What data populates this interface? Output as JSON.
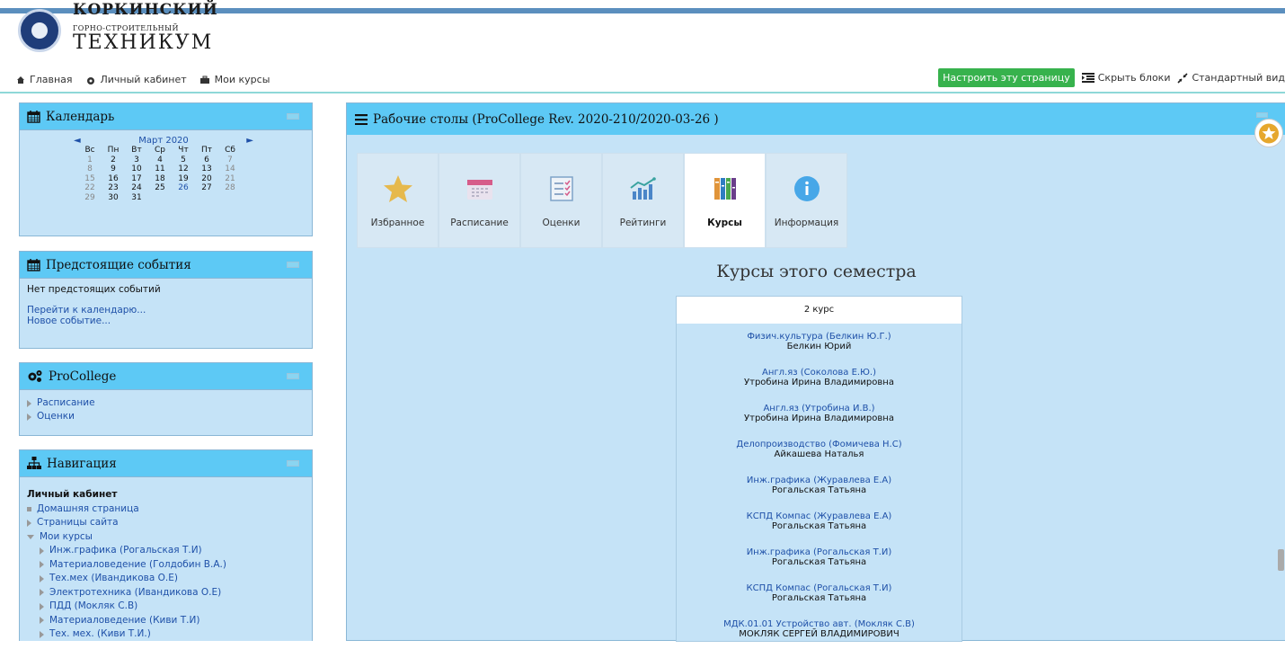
{
  "logo": {
    "line1": "КОРКИНСКИЙ",
    "line2": "ГОРНО-СТРОИТЕЛЬНЫЙ",
    "line3": "ТЕХНИКУМ"
  },
  "nav": {
    "home": "Главная",
    "cabinet": "Личный кабинет",
    "my_courses": "Мои курсы",
    "customize_btn": "Настроить эту страницу",
    "hide_blocks": "Скрыть блоки",
    "standard_view": "Стандартный вид"
  },
  "calendar": {
    "title": "Календарь",
    "prev": "◄",
    "next": "►",
    "month": "Март 2020",
    "weekdays": [
      "Вс",
      "Пн",
      "Вт",
      "Ср",
      "Чт",
      "Пт",
      "Сб"
    ],
    "days": [
      [
        "1",
        "2",
        "3",
        "4",
        "5",
        "6",
        "7"
      ],
      [
        "8",
        "9",
        "10",
        "11",
        "12",
        "13",
        "14"
      ],
      [
        "15",
        "16",
        "17",
        "18",
        "19",
        "20",
        "21"
      ],
      [
        "22",
        "23",
        "24",
        "25",
        "26",
        "27",
        "28"
      ],
      [
        "29",
        "30",
        "31",
        "",
        "",
        "",
        ""
      ]
    ],
    "today": "26"
  },
  "events": {
    "title": "Предстоящие события",
    "empty": "Нет предстоящих событий",
    "goto_calendar": "Перейти к календарю...",
    "new_event": "Новое событие..."
  },
  "procollege": {
    "title": "ProCollege",
    "items": [
      "Расписание",
      "Оценки"
    ]
  },
  "navigation": {
    "title": "Навигация",
    "root": "Личный кабинет",
    "home_page": "Домашняя страница",
    "site_pages": "Страницы сайта",
    "my_courses": "Мои курсы",
    "courses": [
      "Инж.графика (Рогальская Т.И)",
      "Материаловедение (Голдобин В.А.)",
      "Тех.мех (Ивандикова О.Е)",
      "Электротехника (Ивандикова О.Е)",
      "ПДД (Мокляк С.В)",
      "Материаловедение (Киви Т.И)",
      "Тех. мех. (Киви Т.И.)"
    ]
  },
  "main": {
    "title": "Рабочие столы (ProCollege Rev. 2020-210/2020-03-26 )",
    "tabs": [
      {
        "label": "Избранное",
        "icon": "star-icon"
      },
      {
        "label": "Расписание",
        "icon": "calendar-icon"
      },
      {
        "label": "Оценки",
        "icon": "checklist-icon"
      },
      {
        "label": "Рейтинги",
        "icon": "chart-icon"
      },
      {
        "label": "Курсы",
        "icon": "books-icon"
      },
      {
        "label": "Информация",
        "icon": "info-icon"
      }
    ],
    "active_tab": "Курсы",
    "semester_title": "Курсы этого семестра",
    "course_group": "2 курс",
    "courses": [
      {
        "name": "Физич.культура (Белкин Ю.Г.)",
        "teacher": "Белкин Юрий"
      },
      {
        "name": "Англ.яз (Соколова Е.Ю.)",
        "teacher": "Утробина Ирина Владимировна"
      },
      {
        "name": "Англ.яз (Утробина И.В.)",
        "teacher": "Утробина Ирина Владимировна"
      },
      {
        "name": "Делопроизводство (Фомичева Н.С)",
        "teacher": "Айкашева Наталья"
      },
      {
        "name": "Инж.графика (Журавлева Е.А)",
        "teacher": "Рогальская Татьяна"
      },
      {
        "name": "КСПД Компас (Журавлева Е.А)",
        "teacher": "Рогальская Татьяна"
      },
      {
        "name": "Инж.графика (Рогальская Т.И)",
        "teacher": "Рогальская Татьяна"
      },
      {
        "name": "КСПД Компас (Рогальская Т.И)",
        "teacher": "Рогальская Татьяна"
      },
      {
        "name": "МДК.01.01 Устройство авт. (Мокляк С.В)",
        "teacher": "МОКЛЯК СЕРГЕЙ ВЛАДИМИРОВИЧ"
      }
    ]
  },
  "colors": {
    "header_blue": "#5dc9f5",
    "panel_blue": "#c5e3f7",
    "link_blue": "#1e50a8",
    "green_button": "#37b24d"
  }
}
